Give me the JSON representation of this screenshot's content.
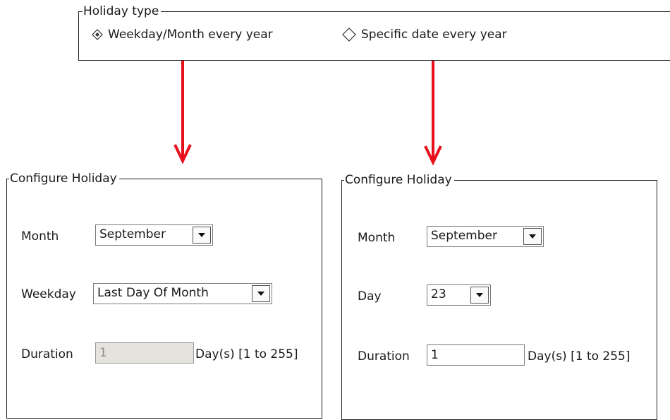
{
  "holiday_type": {
    "legend": "Holiday type",
    "options": [
      {
        "label": "Weekday/Month every year",
        "selected": true
      },
      {
        "label": "Specific date every year",
        "selected": false
      }
    ]
  },
  "left_panel": {
    "legend": "Configure Holiday",
    "month_label": "Month",
    "month_value": "September",
    "weekday_label": "Weekday",
    "weekday_value": "Last Day Of Month",
    "duration_label": "Duration",
    "duration_value": "1",
    "duration_suffix": "Day(s) [1 to 255]",
    "duration_enabled": false
  },
  "right_panel": {
    "legend": "Configure Holiday",
    "month_label": "Month",
    "month_value": "September",
    "day_label": "Day",
    "day_value": "23",
    "duration_label": "Duration",
    "duration_value": "1",
    "duration_suffix": "Day(s) [1 to 255]",
    "duration_enabled": true
  },
  "colors": {
    "arrow": "#e8101a",
    "border": "#202020",
    "disabled_field": "#e4e3de"
  }
}
